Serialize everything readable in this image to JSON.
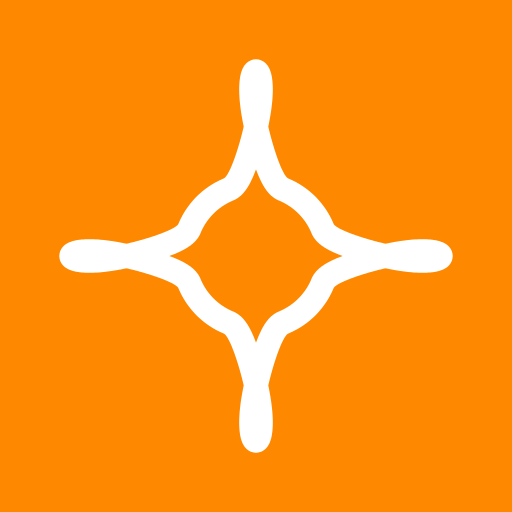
{
  "app_icon": {
    "symbol": "looped-flower-icon",
    "colors": {
      "background": "#fe8800",
      "symbol": "#ffffff"
    },
    "loop_count": 8
  }
}
